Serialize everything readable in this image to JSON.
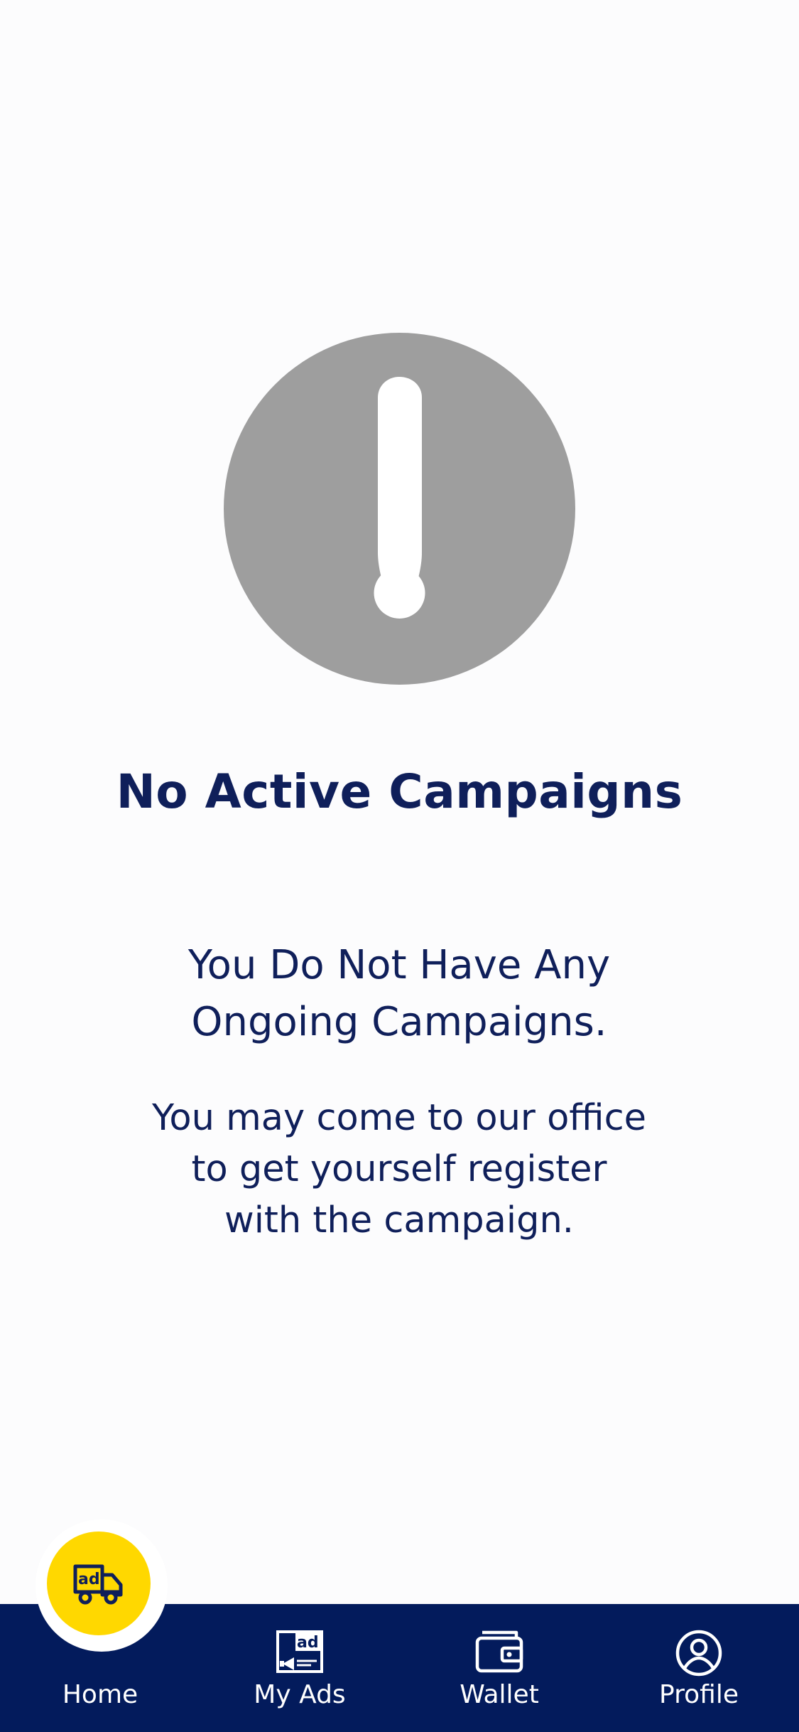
{
  "empty_state": {
    "icon": "exclamation-circle-icon",
    "title": "No Active Campaigns",
    "subtitle_line1": "You Do Not Have Any",
    "subtitle_line2": "Ongoing Campaigns.",
    "message_line1": "You may come to our office",
    "message_line2": "to get yourself register",
    "message_line3": "with the campaign."
  },
  "bottom_nav": {
    "items": [
      {
        "label": "Home",
        "icon": "ad-truck-icon",
        "active": true
      },
      {
        "label": "My Ads",
        "icon": "ad-megaphone-icon",
        "active": false
      },
      {
        "label": "Wallet",
        "icon": "wallet-icon",
        "active": false
      },
      {
        "label": "Profile",
        "icon": "user-circle-icon",
        "active": false
      }
    ]
  },
  "colors": {
    "background": "#fcfcfd",
    "text_primary": "#0f1f5a",
    "icon_gray": "#9e9e9e",
    "nav_background": "#031b5c",
    "accent_yellow": "#ffd800"
  }
}
